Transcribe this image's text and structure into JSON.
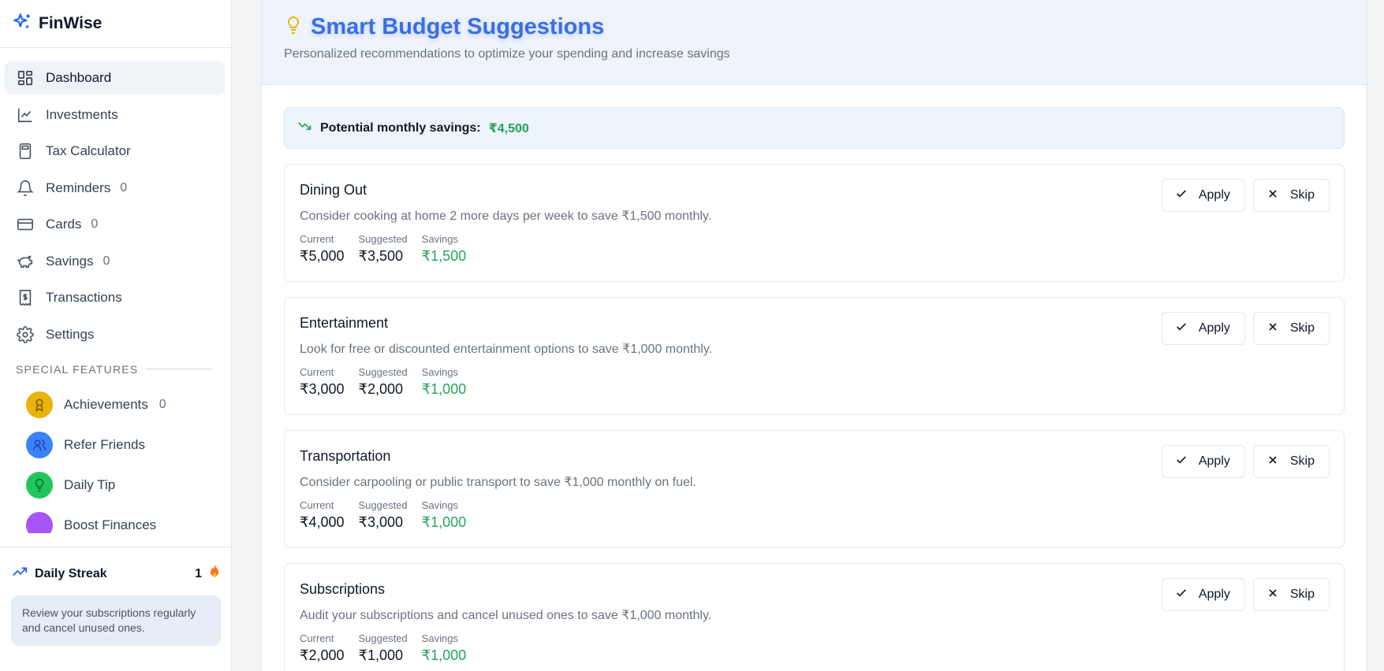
{
  "brand": {
    "name": "FinWise"
  },
  "nav": [
    {
      "label": "Dashboard",
      "icon": "dashboard-icon",
      "count": ""
    },
    {
      "label": "Investments",
      "icon": "line-chart-icon",
      "count": ""
    },
    {
      "label": "Tax Calculator",
      "icon": "calculator-icon",
      "count": ""
    },
    {
      "label": "Reminders",
      "icon": "bell-icon",
      "count": "0"
    },
    {
      "label": "Cards",
      "icon": "credit-card-icon",
      "count": "0"
    },
    {
      "label": "Savings",
      "icon": "piggy-bank-icon",
      "count": "0"
    },
    {
      "label": "Transactions",
      "icon": "receipt-icon",
      "count": ""
    },
    {
      "label": "Settings",
      "icon": "gear-icon",
      "count": ""
    }
  ],
  "special": {
    "title": "SPECIAL FEATURES",
    "items": [
      {
        "label": "Achievements",
        "count": "0",
        "color": "#eab308"
      },
      {
        "label": "Refer Friends",
        "count": "",
        "color": "#3b82f6"
      },
      {
        "label": "Daily Tip",
        "count": "",
        "color": "#22c55e"
      },
      {
        "label": "Boost Finances",
        "count": "",
        "color": "#a855f7"
      }
    ]
  },
  "streak": {
    "label": "Daily Streak",
    "count": "1",
    "tip": "Review your subscriptions regularly and cancel unused ones."
  },
  "header": {
    "title": "Smart Budget Suggestions",
    "subtitle": "Personalized recommendations to optimize your spending and increase savings"
  },
  "banner": {
    "label": "Potential monthly savings:",
    "amount": "₹4,500"
  },
  "labels": {
    "current": "Current",
    "suggested": "Suggested",
    "savings": "Savings",
    "apply": "Apply",
    "skip": "Skip"
  },
  "suggestions": [
    {
      "title": "Dining Out",
      "desc": "Consider cooking at home 2 more days per week to save ₹1,500 monthly.",
      "current": "₹5,000",
      "suggested": "₹3,500",
      "savings": "₹1,500"
    },
    {
      "title": "Entertainment",
      "desc": "Look for free or discounted entertainment options to save ₹1,000 monthly.",
      "current": "₹3,000",
      "suggested": "₹2,000",
      "savings": "₹1,000"
    },
    {
      "title": "Transportation",
      "desc": "Consider carpooling or public transport to save ₹1,000 monthly on fuel.",
      "current": "₹4,000",
      "suggested": "₹3,000",
      "savings": "₹1,000"
    },
    {
      "title": "Subscriptions",
      "desc": "Audit your subscriptions and cancel unused ones to save ₹1,000 monthly.",
      "current": "₹2,000",
      "suggested": "₹1,000",
      "savings": "₹1,000"
    }
  ],
  "colors": {
    "accent": "#3b6fe0",
    "green": "#22a559"
  }
}
